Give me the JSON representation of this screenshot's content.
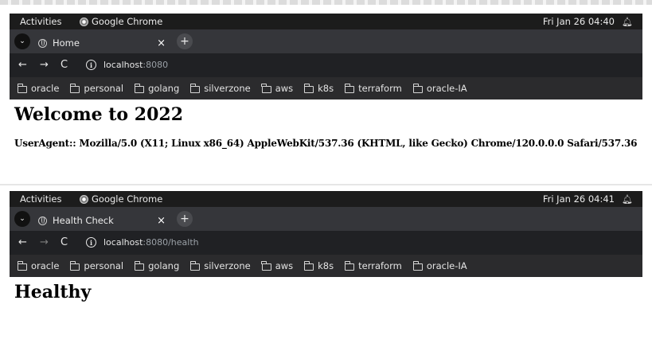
{
  "system_bar": {
    "activities": "Activities",
    "app_name": "Google Chrome"
  },
  "screenshots": [
    {
      "clock": "Fri Jan 26  04:40",
      "tab_title": "Home",
      "url_host": "localhost",
      "url_rest": ":8080",
      "heading": "Welcome to 2022",
      "body_text": "UserAgent:: Mozilla/5.0 (X11; Linux x86_64) AppleWebKit/537.36 (KHTML, like Gecko) Chrome/120.0.0.0 Safari/537.36"
    },
    {
      "clock": "Fri Jan 26  04:41",
      "tab_title": "Health Check",
      "url_host": "localhost",
      "url_rest": ":8080/health",
      "heading": "Healthy"
    }
  ],
  "browser": {
    "tab_close": "×",
    "new_tab": "+",
    "back": "←",
    "forward": "→",
    "reload": "C",
    "info": "i",
    "tab_search": "⌄"
  },
  "bookmarks": [
    "oracle",
    "personal",
    "golang",
    "silverzone",
    "aws",
    "k8s",
    "terraform",
    "oracle-IA"
  ]
}
